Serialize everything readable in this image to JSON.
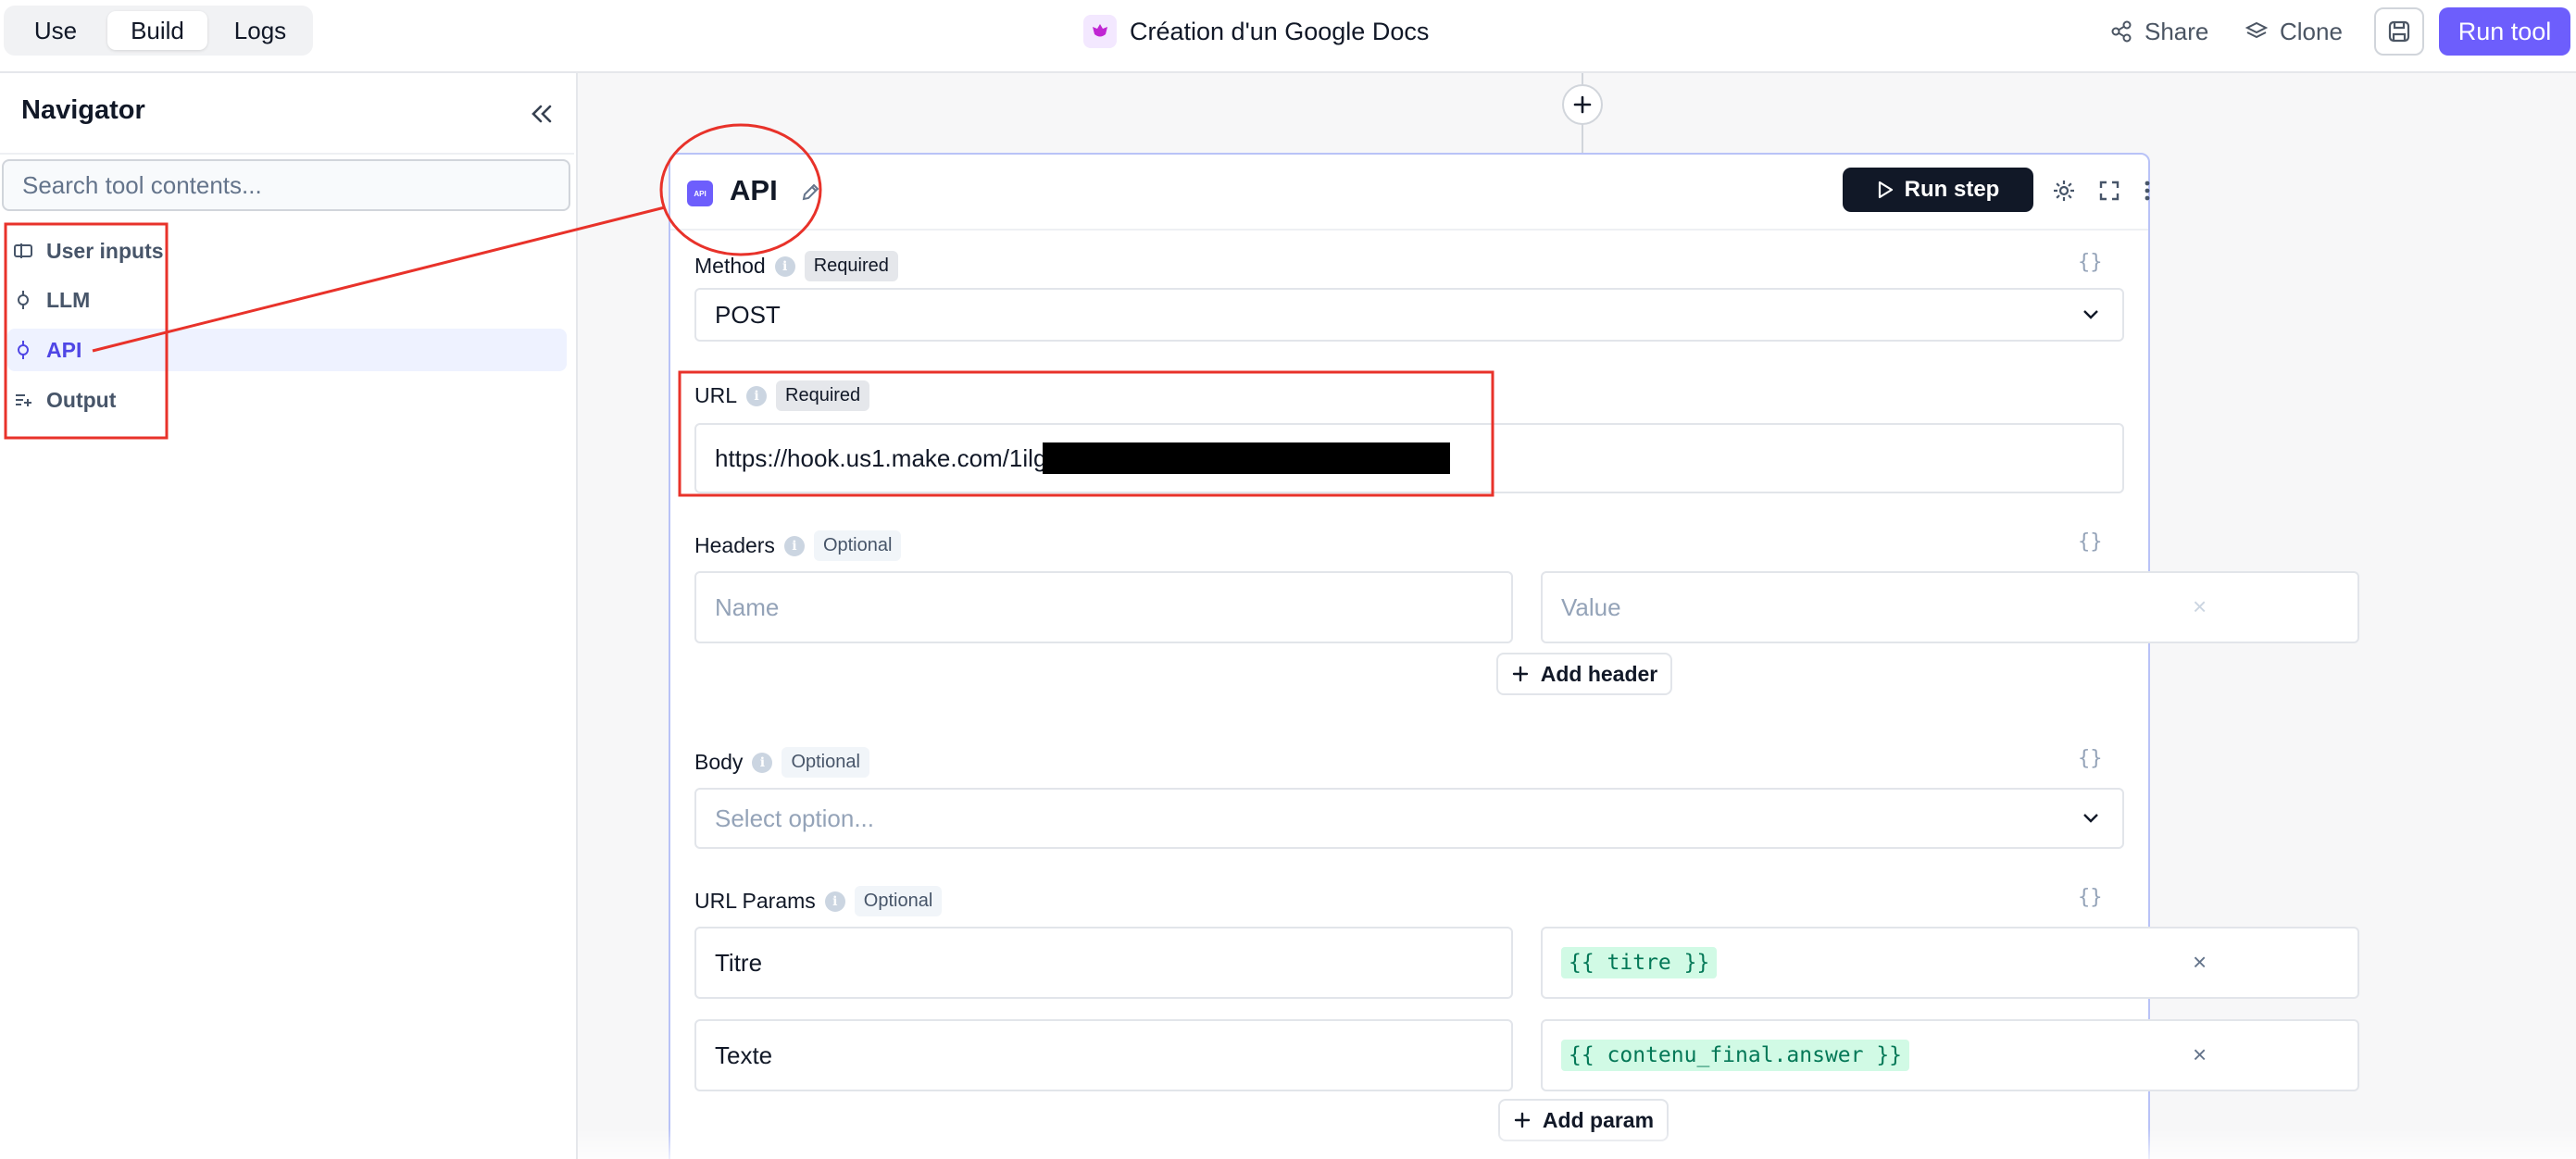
{
  "topbar": {
    "tabs": [
      {
        "label": "Use",
        "active": false
      },
      {
        "label": "Build",
        "active": true
      },
      {
        "label": "Logs",
        "active": false
      }
    ],
    "doc_title": "Création d'un Google Docs",
    "share_label": "Share",
    "clone_label": "Clone",
    "run_tool_label": "Run tool"
  },
  "sidebar": {
    "title": "Navigator",
    "search_placeholder": "Search tool contents...",
    "items": [
      {
        "label": "User inputs",
        "icon": "input-icon",
        "active": false
      },
      {
        "label": "LLM",
        "icon": "node-icon",
        "active": false
      },
      {
        "label": "API",
        "icon": "node-icon",
        "active": true
      },
      {
        "label": "Output",
        "icon": "output-icon",
        "active": false
      }
    ]
  },
  "step": {
    "badge_text": "API",
    "title": "API",
    "run_step_label": "Run step",
    "method": {
      "label": "Method",
      "badge": "Required",
      "value": "POST"
    },
    "url": {
      "label": "URL",
      "badge": "Required",
      "value": "https://hook.us1.make.com/1ilg"
    },
    "headers": {
      "label": "Headers",
      "badge": "Optional",
      "name_placeholder": "Name",
      "value_placeholder": "Value",
      "add_label": "Add header"
    },
    "body": {
      "label": "Body",
      "badge": "Optional",
      "placeholder": "Select option..."
    },
    "url_params": {
      "label": "URL Params",
      "badge": "Optional",
      "rows": [
        {
          "name": "Titre",
          "value": "{{ titre }}"
        },
        {
          "name": "Texte",
          "value": "{{ contenu_final.answer }}"
        }
      ],
      "add_label": "Add param"
    },
    "braces": "{}",
    "remove_glyph": "×"
  },
  "colors": {
    "accent": "#6d5efc",
    "annotation": "#e8322a",
    "active_bg": "#eef2ff",
    "template_bg": "#d1fae5",
    "template_text": "#047857"
  }
}
